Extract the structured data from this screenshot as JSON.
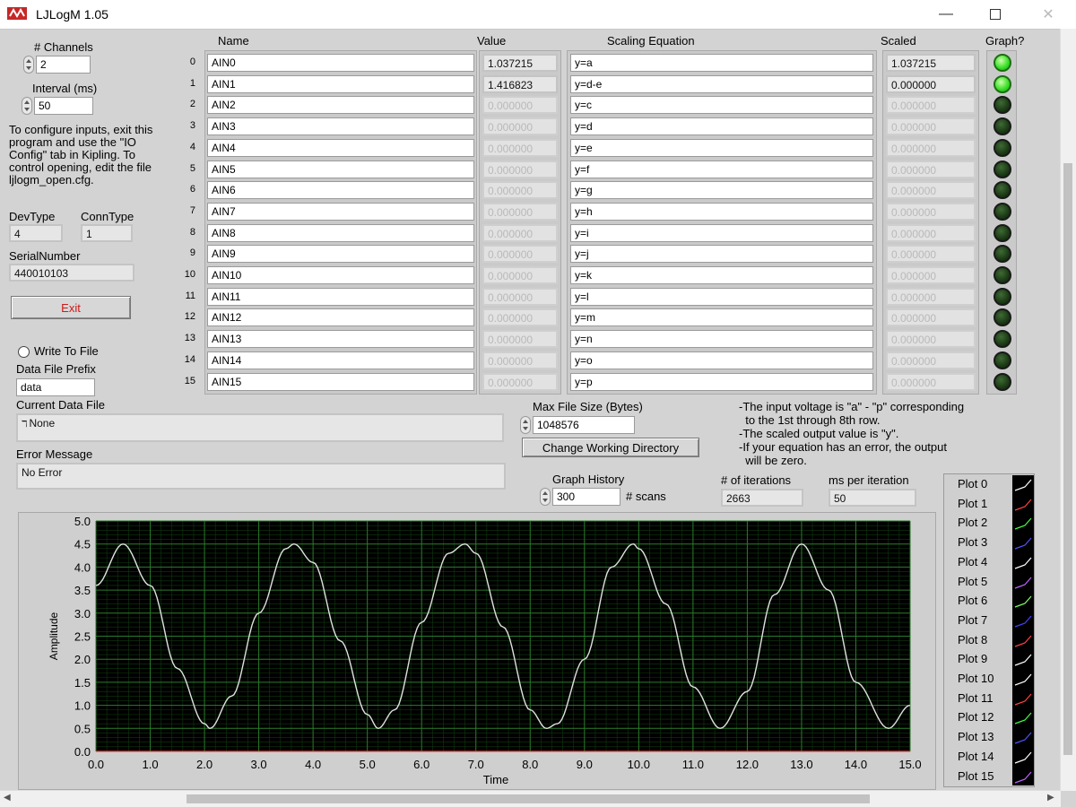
{
  "window": {
    "title": "LJLogM 1.05"
  },
  "controls": {
    "channels_label": "# Channels",
    "channels_value": "2",
    "interval_label": "Interval (ms)",
    "interval_value": "50",
    "config_note": "To configure inputs, exit this program and use the \"IO Config\" tab in Kipling.  To control opening, edit the file ljlogm_open.cfg.",
    "devtype_label": "DevType",
    "devtype_value": "4",
    "conntype_label": "ConnType",
    "conntype_value": "1",
    "serial_label": "SerialNumber",
    "serial_value": "440010103",
    "exit_label": "Exit",
    "write_to_file_label": "Write To File",
    "prefix_label": "Data File Prefix",
    "prefix_value": "data",
    "current_file_label": "Current Data File",
    "current_file_value": "None",
    "error_label": "Error Message",
    "error_value": "No Error"
  },
  "table": {
    "headers": {
      "name": "Name",
      "value": "Value",
      "equation": "Scaling Equation",
      "scaled": "Scaled",
      "graph": "Graph?"
    },
    "rows": [
      {
        "idx": "0",
        "name": "AIN0",
        "value": "1.037215",
        "equation": "y=a",
        "scaled": "1.037215",
        "graph": true,
        "active": true
      },
      {
        "idx": "1",
        "name": "AIN1",
        "value": "1.416823",
        "equation": "y=d-e",
        "scaled": "0.000000",
        "graph": true,
        "active": true
      },
      {
        "idx": "2",
        "name": "AIN2",
        "value": "0.000000",
        "equation": "y=c",
        "scaled": "0.000000",
        "graph": false,
        "active": false
      },
      {
        "idx": "3",
        "name": "AIN3",
        "value": "0.000000",
        "equation": "y=d",
        "scaled": "0.000000",
        "graph": false,
        "active": false
      },
      {
        "idx": "4",
        "name": "AIN4",
        "value": "0.000000",
        "equation": "y=e",
        "scaled": "0.000000",
        "graph": false,
        "active": false
      },
      {
        "idx": "5",
        "name": "AIN5",
        "value": "0.000000",
        "equation": "y=f",
        "scaled": "0.000000",
        "graph": false,
        "active": false
      },
      {
        "idx": "6",
        "name": "AIN6",
        "value": "0.000000",
        "equation": "y=g",
        "scaled": "0.000000",
        "graph": false,
        "active": false
      },
      {
        "idx": "7",
        "name": "AIN7",
        "value": "0.000000",
        "equation": "y=h",
        "scaled": "0.000000",
        "graph": false,
        "active": false
      },
      {
        "idx": "8",
        "name": "AIN8",
        "value": "0.000000",
        "equation": "y=i",
        "scaled": "0.000000",
        "graph": false,
        "active": false
      },
      {
        "idx": "9",
        "name": "AIN9",
        "value": "0.000000",
        "equation": "y=j",
        "scaled": "0.000000",
        "graph": false,
        "active": false
      },
      {
        "idx": "10",
        "name": "AIN10",
        "value": "0.000000",
        "equation": "y=k",
        "scaled": "0.000000",
        "graph": false,
        "active": false
      },
      {
        "idx": "11",
        "name": "AIN11",
        "value": "0.000000",
        "equation": "y=l",
        "scaled": "0.000000",
        "graph": false,
        "active": false
      },
      {
        "idx": "12",
        "name": "AIN12",
        "value": "0.000000",
        "equation": "y=m",
        "scaled": "0.000000",
        "graph": false,
        "active": false
      },
      {
        "idx": "13",
        "name": "AIN13",
        "value": "0.000000",
        "equation": "y=n",
        "scaled": "0.000000",
        "graph": false,
        "active": false
      },
      {
        "idx": "14",
        "name": "AIN14",
        "value": "0.000000",
        "equation": "y=o",
        "scaled": "0.000000",
        "graph": false,
        "active": false
      },
      {
        "idx": "15",
        "name": "AIN15",
        "value": "0.000000",
        "equation": "y=p",
        "scaled": "0.000000",
        "graph": false,
        "active": false
      }
    ]
  },
  "file": {
    "max_size_label": "Max File Size (Bytes)",
    "max_size_value": "1048576",
    "change_dir_label": "Change Working Directory"
  },
  "notes": [
    "-The input voltage is \"a\" - \"p\" corresponding",
    "  to the 1st through 8th row.",
    "-The scaled output value is \"y\".",
    "-If your equation has an error, the output",
    "  will be zero."
  ],
  "history": {
    "label": "Graph History",
    "value": "300",
    "unit": "# scans",
    "iterations_label": "# of iterations",
    "iterations_value": "2663",
    "ms_label": "ms per iteration",
    "ms_value": "50"
  },
  "legend": {
    "items": [
      "Plot 0",
      "Plot 1",
      "Plot 2",
      "Plot 3",
      "Plot 4",
      "Plot 5",
      "Plot 6",
      "Plot 7",
      "Plot 8",
      "Plot 9",
      "Plot 10",
      "Plot 11",
      "Plot 12",
      "Plot 13",
      "Plot 14",
      "Plot 15"
    ],
    "colors": [
      "#ffffff",
      "#ff4040",
      "#40ff40",
      "#5050ff",
      "#ffffff",
      "#c060ff",
      "#80ff60",
      "#4040ff",
      "#ff4040",
      "#ffffff",
      "#ffffff",
      "#ff4040",
      "#40ff40",
      "#5050ff",
      "#ffffff",
      "#c060ff"
    ]
  },
  "chart_data": {
    "type": "line",
    "xlabel": "Time",
    "ylabel": "Amplitude",
    "xlim": [
      0,
      15
    ],
    "ylim": [
      0,
      5
    ],
    "x_ticks": [
      "0.0",
      "1.0",
      "2.0",
      "3.0",
      "4.0",
      "5.0",
      "6.0",
      "7.0",
      "8.0",
      "9.0",
      "10.0",
      "11.0",
      "12.0",
      "13.0",
      "14.0",
      "15.0"
    ],
    "y_ticks": [
      "0.0",
      "0.5",
      "1.0",
      "1.5",
      "2.0",
      "2.5",
      "3.0",
      "3.5",
      "4.0",
      "4.5",
      "5.0"
    ],
    "grid": true,
    "series": [
      {
        "color": "#e0e0e0",
        "x": [
          0,
          0.5,
          1.0,
          1.5,
          2.0,
          2.1,
          2.5,
          3.0,
          3.5,
          3.65,
          4.0,
          4.5,
          5.0,
          5.2,
          5.5,
          6.0,
          6.5,
          6.8,
          7.0,
          7.5,
          8.0,
          8.3,
          8.5,
          9.0,
          9.5,
          9.9,
          10.0,
          10.5,
          11.0,
          11.5,
          12.0,
          12.5,
          13.0,
          13.5,
          14.0,
          14.6,
          15.0
        ],
        "y": [
          3.6,
          4.5,
          3.6,
          1.8,
          0.6,
          0.5,
          1.2,
          3.0,
          4.4,
          4.5,
          4.1,
          2.4,
          0.8,
          0.5,
          0.9,
          2.8,
          4.3,
          4.5,
          4.3,
          2.7,
          0.9,
          0.5,
          0.6,
          2.0,
          4.0,
          4.5,
          4.4,
          3.2,
          1.4,
          0.5,
          1.3,
          3.4,
          4.5,
          3.5,
          1.5,
          0.5,
          1.0
        ]
      },
      {
        "color": "#ff4040",
        "x": [
          0,
          15
        ],
        "y": [
          0,
          0
        ]
      }
    ]
  }
}
